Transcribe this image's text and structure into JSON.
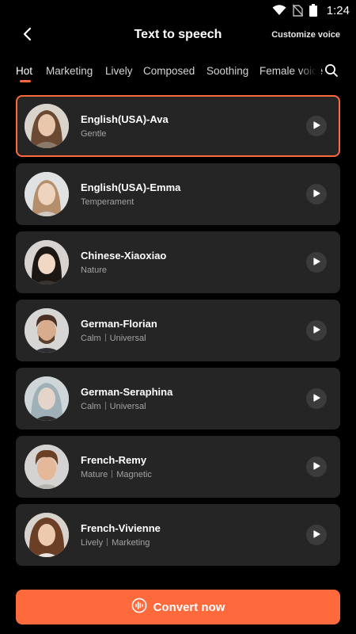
{
  "status_bar": {
    "time": "1:24",
    "icons": [
      "wifi-icon",
      "no-sim-icon",
      "battery-icon"
    ]
  },
  "header": {
    "title": "Text to speech",
    "customize_label": "Customize voice",
    "back_icon": "chevron-left-icon"
  },
  "tabs": [
    {
      "label": "Hot",
      "active": true
    },
    {
      "label": "Marketing",
      "active": false
    },
    {
      "label": "Lively",
      "active": false
    },
    {
      "label": "Composed",
      "active": false
    },
    {
      "label": "Soothing",
      "active": false
    },
    {
      "label": "Female voice",
      "active": false
    }
  ],
  "search_icon": "search-icon",
  "voices": [
    {
      "name": "English(USA)-Ava",
      "tags": [
        "Gentle"
      ],
      "selected": true,
      "avatar": "avatar-ava"
    },
    {
      "name": "English(USA)-Emma",
      "tags": [
        "Temperament"
      ],
      "selected": false,
      "avatar": "avatar-emma"
    },
    {
      "name": "Chinese-Xiaoxiao",
      "tags": [
        "Nature"
      ],
      "selected": false,
      "avatar": "avatar-xiaoxiao"
    },
    {
      "name": "German-Florian",
      "tags": [
        "Calm",
        "Universal"
      ],
      "selected": false,
      "avatar": "avatar-florian"
    },
    {
      "name": "German-Seraphina",
      "tags": [
        "Calm",
        "Universal"
      ],
      "selected": false,
      "avatar": "avatar-seraphina"
    },
    {
      "name": "French-Remy",
      "tags": [
        "Mature",
        "Magnetic"
      ],
      "selected": false,
      "avatar": "avatar-remy"
    },
    {
      "name": "French-Vivienne",
      "tags": [
        "Lively",
        "Marketing"
      ],
      "selected": false,
      "avatar": "avatar-vivienne"
    }
  ],
  "convert": {
    "label": "Convert now",
    "icon": "audio-wave-icon"
  },
  "colors": {
    "accent": "#ff6a3d",
    "card": "#252525",
    "background": "#000000"
  }
}
